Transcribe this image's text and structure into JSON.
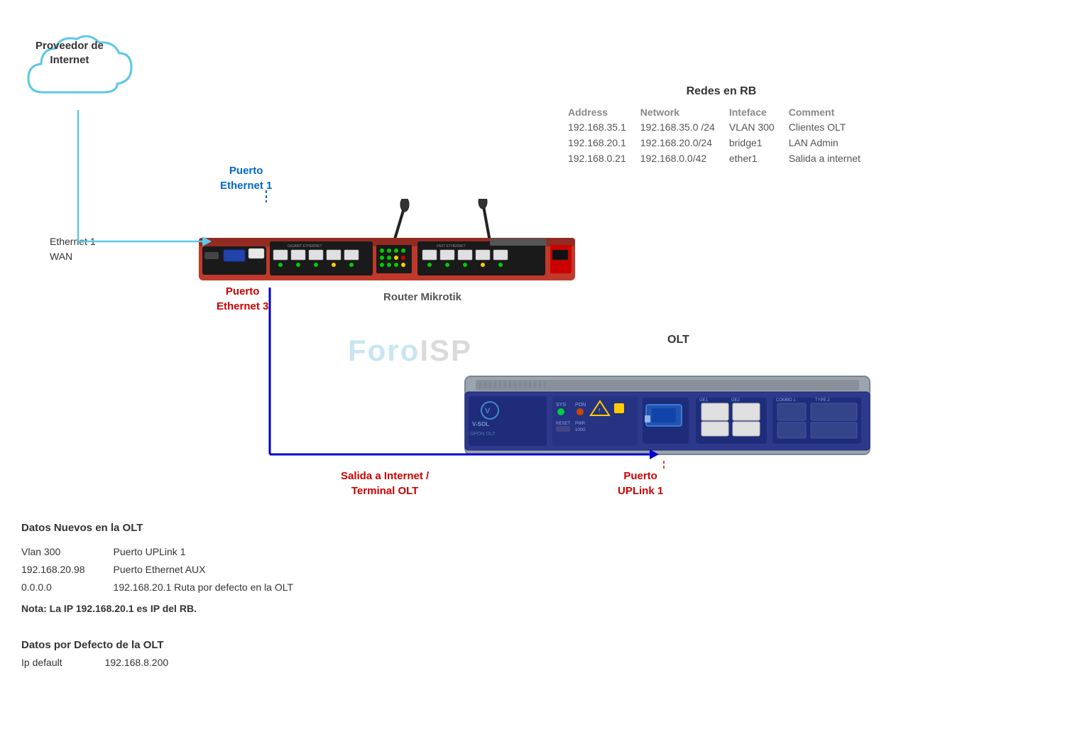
{
  "cloud": {
    "label_line1": "Proveedor de",
    "label_line2": "Internet"
  },
  "labels": {
    "eth1_wan_line1": "Ethernet 1",
    "eth1_wan_line2": "WAN",
    "puerto_eth1_line1": "Puerto",
    "puerto_eth1_line2": "Ethernet 1",
    "puerto_eth3_line1": "Puerto",
    "puerto_eth3_line2": "Ethernet 3",
    "router_mikrotik": "Router Mikrotik",
    "olt": "OLT",
    "salida_line1": "Salida a Internet /",
    "salida_line2": "Terminal  OLT",
    "uplink_line1": "Puerto",
    "uplink_line2": "UPLink 1",
    "watermark": "ForoISP"
  },
  "redes_rb": {
    "title": "Redes en RB",
    "headers": [
      "Address",
      "Network",
      "Inteface",
      "Comment"
    ],
    "rows": [
      [
        "192.168.35.1",
        "192.168.35.0 /24",
        "VLAN 300",
        "Clientes OLT"
      ],
      [
        "192.168.20.1",
        "192.168.20.0/24",
        "bridge1",
        "LAN Admin"
      ],
      [
        "192.168.0.21",
        "192.168.0.0/42",
        "ether1",
        "Salida a internet"
      ]
    ]
  },
  "datos_nuevos": {
    "title": "Datos Nuevos en  la OLT",
    "row1_col1": "Vlan 300",
    "row1_col2": "Puerto UPLink 1",
    "row2_col1": "192.168.20.98",
    "row2_col2": "Puerto Ethernet AUX",
    "row3_col1": "0.0.0.0",
    "row3_col2": "192.168.20.1    Ruta  por defecto en la OLT",
    "nota": "Nota: La IP 192.168.20.1 es IP del RB."
  },
  "datos_defecto": {
    "title": "Datos por Defecto de la OLT",
    "label": "Ip default",
    "value": "192.168.8.200"
  }
}
